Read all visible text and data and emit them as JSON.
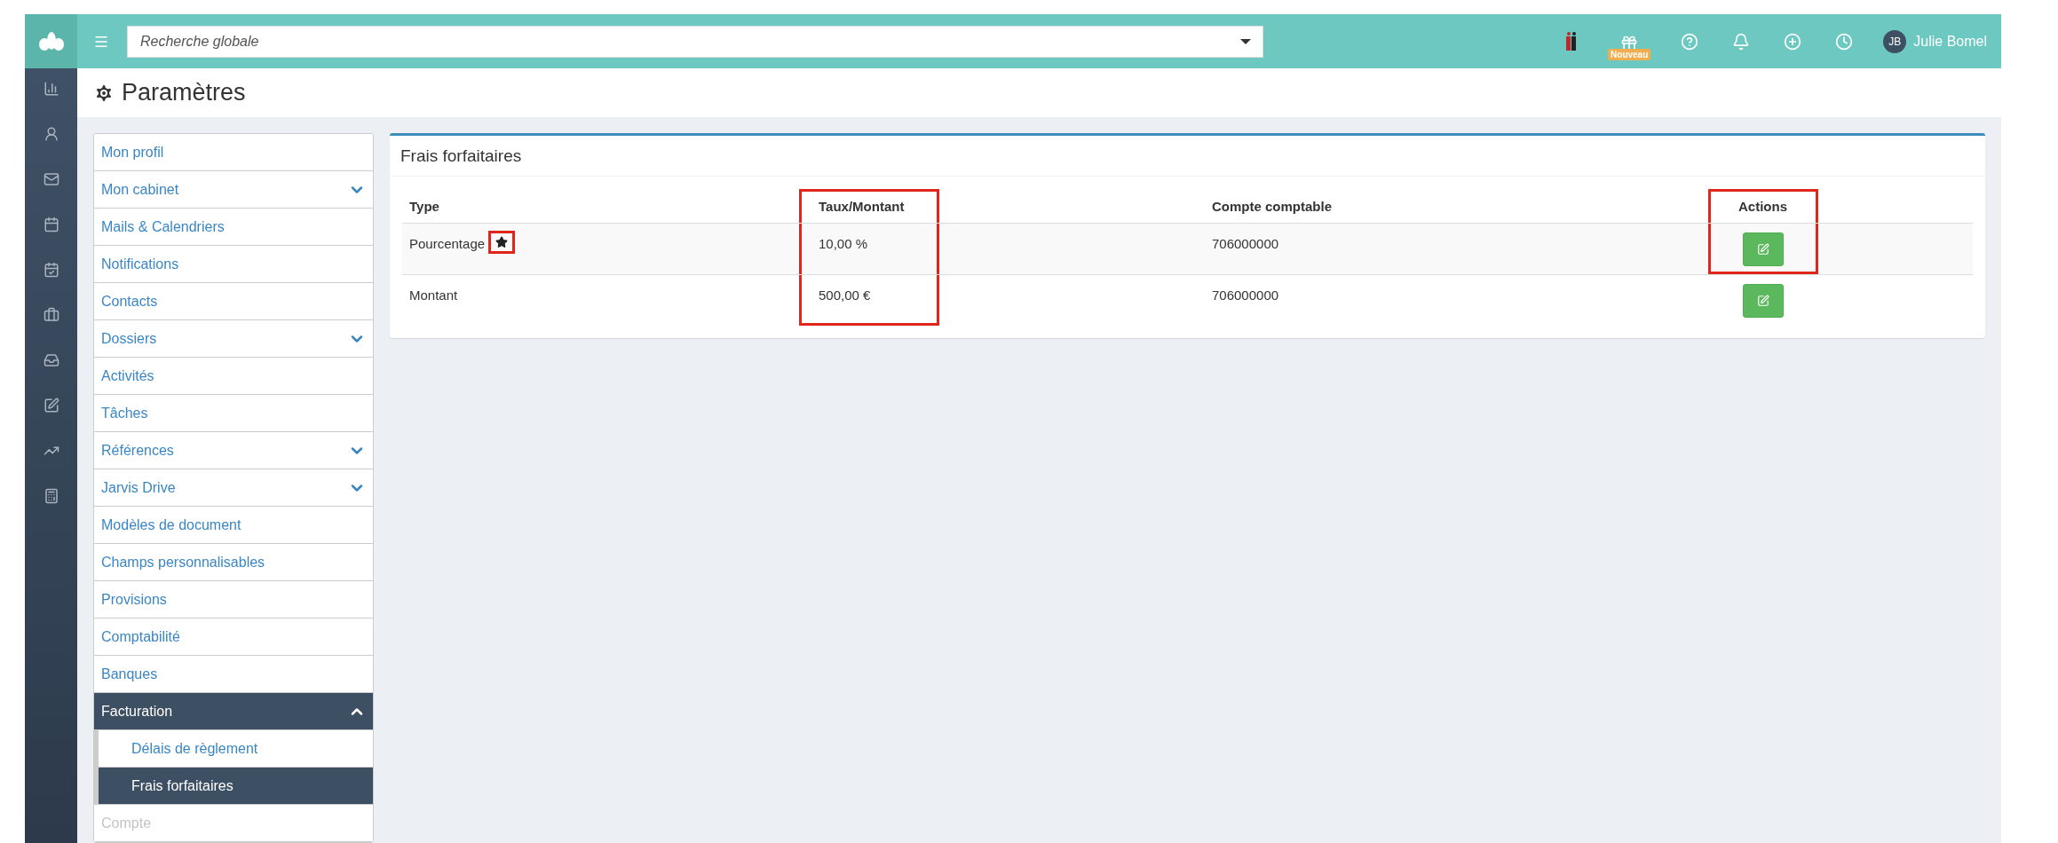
{
  "topbar": {
    "search": {
      "placeholder": "Recherche globale"
    },
    "badge": "Nouveau",
    "user": {
      "initials": "JB",
      "name": "Julie Bomel"
    }
  },
  "page": {
    "title": "Paramètres"
  },
  "menu": {
    "items": [
      {
        "label": "Mon profil",
        "selected": false,
        "disabled": false
      },
      {
        "label": "Mon cabinet",
        "expanded": false,
        "selected": false,
        "disabled": false
      },
      {
        "label": "Mails & Calendriers",
        "selected": false,
        "disabled": false
      },
      {
        "label": "Notifications",
        "selected": false,
        "disabled": false
      },
      {
        "label": "Contacts",
        "selected": false,
        "disabled": false
      },
      {
        "label": "Dossiers",
        "expanded": false,
        "selected": false,
        "disabled": false
      },
      {
        "label": "Activités",
        "selected": false,
        "disabled": false
      },
      {
        "label": "Tâches",
        "selected": false,
        "disabled": false
      },
      {
        "label": "Références",
        "expanded": false,
        "selected": false,
        "disabled": false
      },
      {
        "label": "Jarvis Drive",
        "expanded": false,
        "selected": false,
        "disabled": false
      },
      {
        "label": "Modèles de document",
        "selected": false,
        "disabled": false
      },
      {
        "label": "Champs personnalisables",
        "selected": false,
        "disabled": false
      },
      {
        "label": "Provisions",
        "selected": false,
        "disabled": false
      },
      {
        "label": "Comptabilité",
        "selected": false,
        "disabled": false
      },
      {
        "label": "Banques",
        "selected": false,
        "disabled": false
      },
      {
        "label": "Facturation",
        "expanded": true,
        "selected": true,
        "disabled": false,
        "children": [
          {
            "label": "Délais de règlement",
            "selected": false
          },
          {
            "label": "Frais forfaitaires",
            "selected": true
          }
        ]
      },
      {
        "label": "Compte",
        "selected": false,
        "disabled": true
      }
    ]
  },
  "panel": {
    "title": "Frais forfaitaires",
    "columns": [
      {
        "label": "Type",
        "marked": false
      },
      {
        "label": "Taux/Montant",
        "marked": true
      },
      {
        "label": "Compte comptable",
        "marked": false
      },
      {
        "label": "Actions",
        "marked": true
      }
    ],
    "rows": [
      {
        "type": "Pourcentage",
        "starred": true,
        "star_marked": true,
        "amount": "10,00 %",
        "amount_marked": true,
        "account": "706000000",
        "action_marked": true
      },
      {
        "type": "Montant",
        "starred": false,
        "amount": "500,00 €",
        "amount_marked": true,
        "account": "706000000",
        "action_marked": false
      }
    ]
  }
}
